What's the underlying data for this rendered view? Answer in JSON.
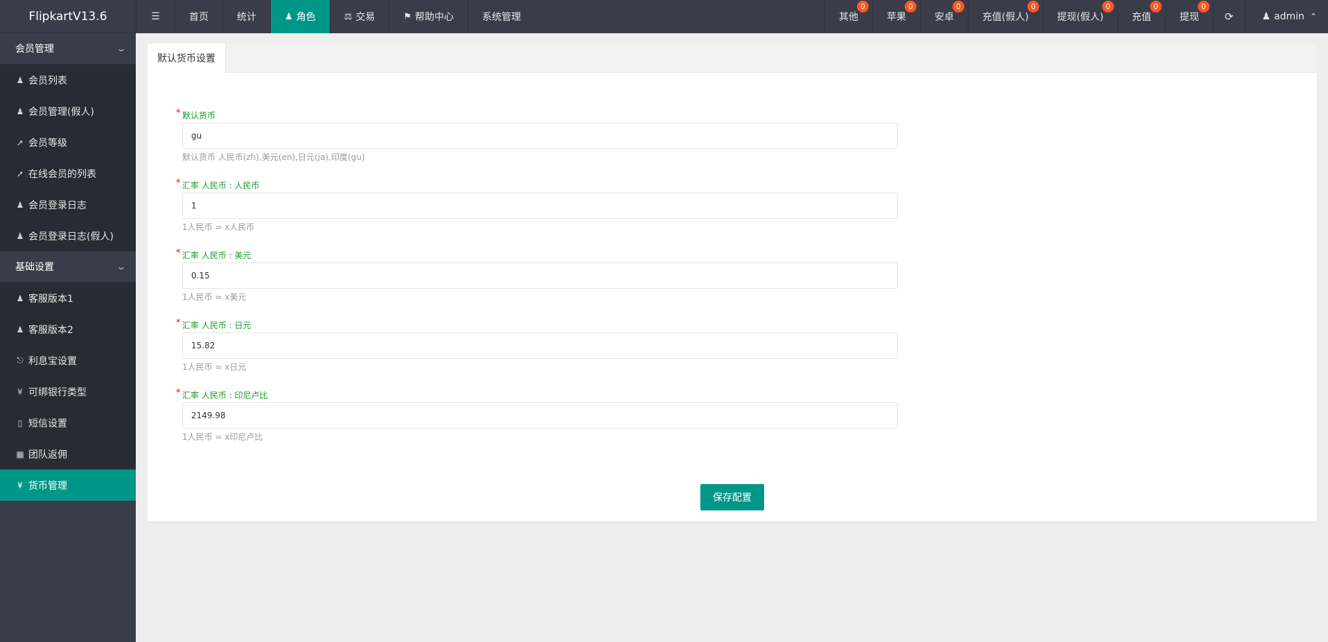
{
  "app": {
    "logo": "FlipkartV13.6"
  },
  "topnav": {
    "toggle_icon": "menu-icon",
    "items": [
      {
        "label": "首页",
        "icon": ""
      },
      {
        "label": "统计",
        "icon": ""
      },
      {
        "label": "角色",
        "icon": "user-icon"
      },
      {
        "label": "交易",
        "icon": "scale-icon"
      },
      {
        "label": "帮助中心",
        "icon": "flag-icon"
      },
      {
        "label": "系统管理",
        "icon": ""
      }
    ],
    "right": [
      {
        "label": "其他",
        "badge": "0"
      },
      {
        "label": "苹果",
        "badge": "0"
      },
      {
        "label": "安卓",
        "badge": "0"
      },
      {
        "label": "充值(假人)",
        "badge": "0"
      },
      {
        "label": "提现(假人)",
        "badge": "0"
      },
      {
        "label": "充值",
        "badge": "0"
      },
      {
        "label": "提现",
        "badge": "0"
      }
    ],
    "user": "admin"
  },
  "sidebar": {
    "group1": {
      "title": "会员管理",
      "items": [
        {
          "label": "会员列表",
          "icon": "user-icon"
        },
        {
          "label": "会员管理(假人)",
          "icon": "user-icon"
        },
        {
          "label": "会员等级",
          "icon": "rocket-icon"
        },
        {
          "label": "在线会员的列表",
          "icon": "rocket-icon"
        },
        {
          "label": "会员登录日志",
          "icon": "user-icon"
        },
        {
          "label": "会员登录日志(假人)",
          "icon": "user-icon"
        }
      ]
    },
    "group2": {
      "title": "基础设置",
      "items": [
        {
          "label": "客服版本1",
          "icon": "user-icon"
        },
        {
          "label": "客服版本2",
          "icon": "user-icon"
        },
        {
          "label": "利息宝设置",
          "icon": "lock-icon"
        },
        {
          "label": "可绑银行类型",
          "icon": "yen-icon"
        },
        {
          "label": "短信设置",
          "icon": "phone-icon"
        },
        {
          "label": "团队返佣",
          "icon": "grid-icon"
        },
        {
          "label": "货币管理",
          "icon": "yen-icon"
        }
      ]
    }
  },
  "panel": {
    "tab": "默认货币设置",
    "fields": [
      {
        "label": "默认货币",
        "value": "gu",
        "hint": "默认货币 人民币(zh),美元(en),日元(ja),印度(gu)"
      },
      {
        "label": "汇率 人民币 : 人民币",
        "value": "1",
        "hint": "1人民币 = x人民币"
      },
      {
        "label": "汇率 人民币 : 美元",
        "value": "0.15",
        "hint": "1人民币 = x美元"
      },
      {
        "label": "汇率 人民币 : 日元",
        "value": "15.82",
        "hint": "1人民币 = x日元"
      },
      {
        "label": "汇率 人民币 : 印尼卢比",
        "value": "2149.98",
        "hint": "1人民币 = x印尼卢比"
      }
    ],
    "required_mark": "*",
    "save_label": "保存配置"
  },
  "colors": {
    "accent": "#009688",
    "sidebar": "#393d49",
    "badge": "#ff5722",
    "label": "#159b2a"
  }
}
